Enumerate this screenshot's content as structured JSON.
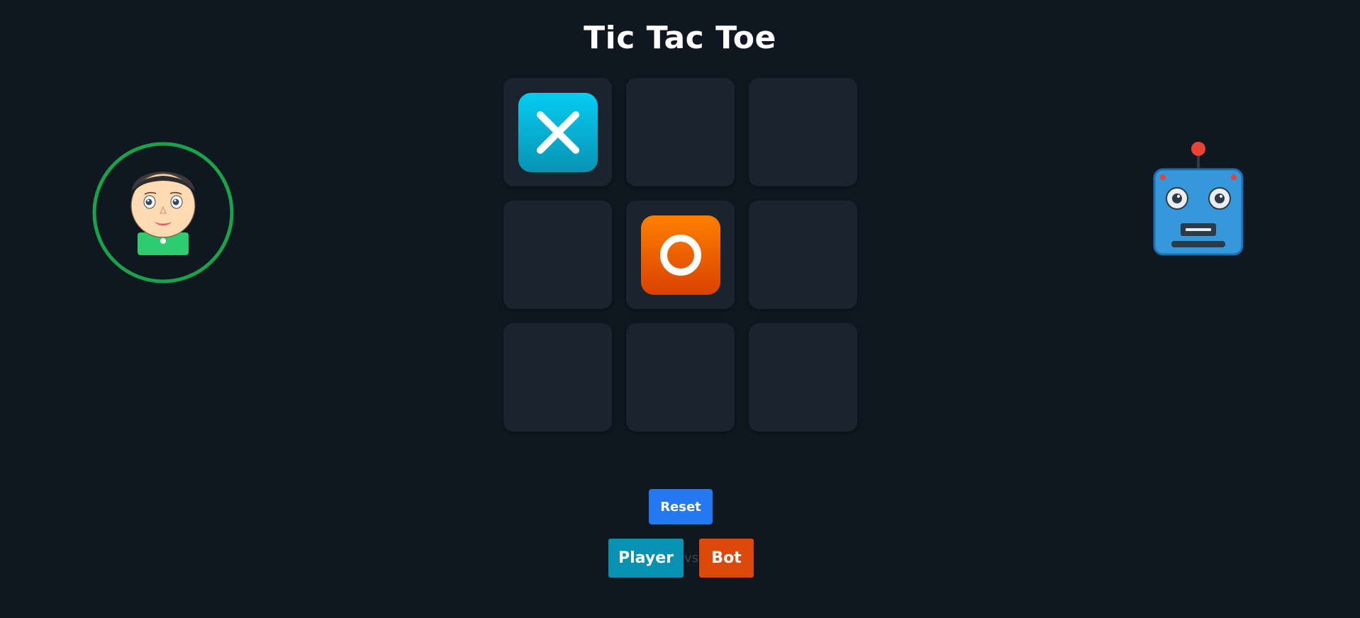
{
  "title": "Tic Tac Toe",
  "board": [
    {
      "value": "X"
    },
    {
      "value": ""
    },
    {
      "value": ""
    },
    {
      "value": ""
    },
    {
      "value": "O"
    },
    {
      "value": ""
    },
    {
      "value": ""
    },
    {
      "value": ""
    },
    {
      "value": ""
    }
  ],
  "controls": {
    "reset_label": "Reset"
  },
  "scoreboard": {
    "player_label": "Player",
    "vs_label": "vs",
    "bot_label": "Bot"
  },
  "icons": {
    "player": "player-avatar-icon",
    "bot": "robot-icon",
    "x": "x-mark-icon",
    "o": "o-mark-icon"
  },
  "colors": {
    "background": "#0f1720",
    "cell": "#1a242f",
    "x_mark": "#06b6d4",
    "o_mark": "#f97316",
    "active_ring": "#16a34a",
    "reset": "#2478f1",
    "player_chip": "#0891b2",
    "bot_chip": "#dc4a0b"
  }
}
